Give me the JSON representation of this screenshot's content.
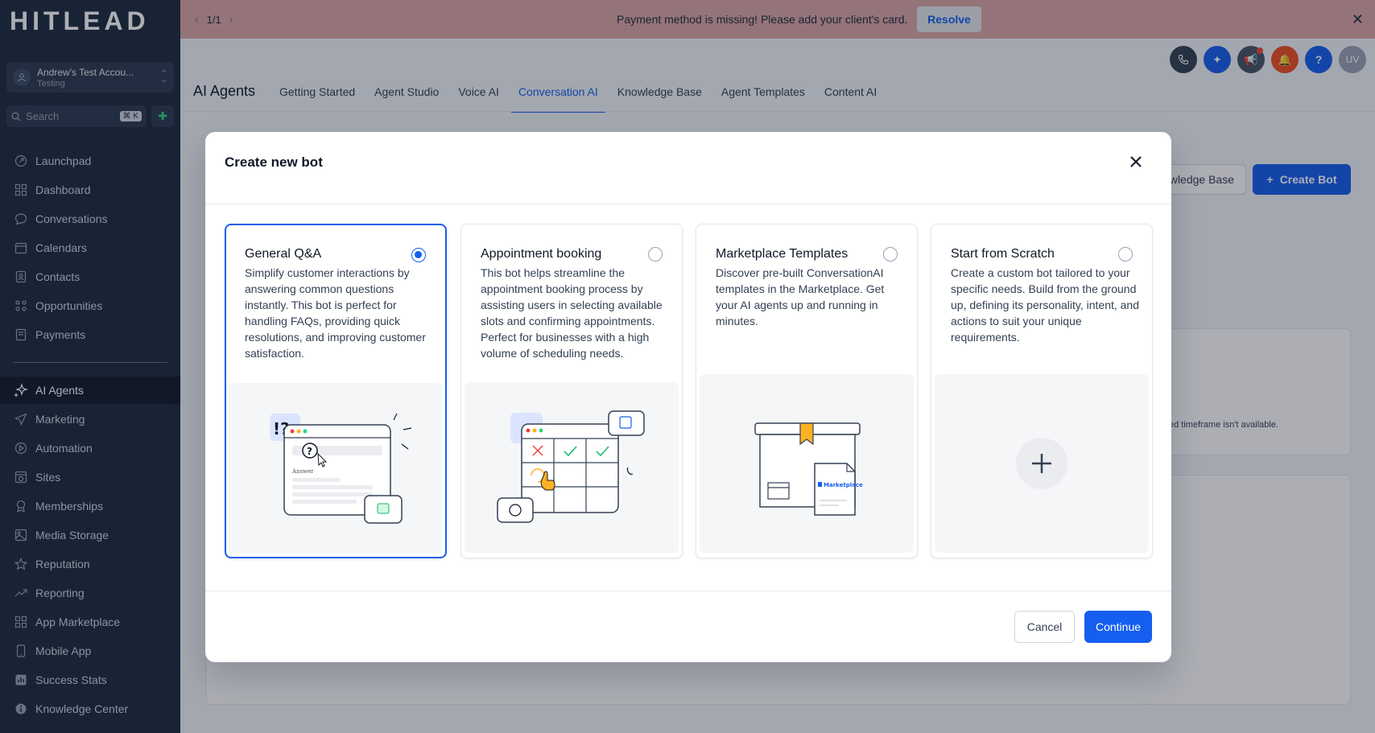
{
  "sidebar": {
    "logo": "HITLEAD",
    "account": {
      "name": "Andrew's Test Accou...",
      "subtitle": "Testing"
    },
    "search": {
      "placeholder": "Search",
      "shortcut": "⌘ K"
    },
    "items": [
      {
        "label": "Launchpad",
        "icon": "rocket-icon"
      },
      {
        "label": "Dashboard",
        "icon": "grid-icon"
      },
      {
        "label": "Conversations",
        "icon": "chat-icon"
      },
      {
        "label": "Calendars",
        "icon": "calendar-icon"
      },
      {
        "label": "Contacts",
        "icon": "contacts-icon"
      },
      {
        "label": "Opportunities",
        "icon": "opportunities-icon"
      },
      {
        "label": "Payments",
        "icon": "payments-icon"
      }
    ],
    "items2": [
      {
        "label": "AI Agents",
        "icon": "sparkle-icon",
        "active": true
      },
      {
        "label": "Marketing",
        "icon": "send-icon"
      },
      {
        "label": "Automation",
        "icon": "automation-icon"
      },
      {
        "label": "Sites",
        "icon": "sites-icon"
      },
      {
        "label": "Memberships",
        "icon": "memberships-icon"
      },
      {
        "label": "Media Storage",
        "icon": "image-icon"
      },
      {
        "label": "Reputation",
        "icon": "star-icon"
      },
      {
        "label": "Reporting",
        "icon": "trend-icon"
      },
      {
        "label": "App Marketplace",
        "icon": "apps-icon"
      },
      {
        "label": "Mobile App",
        "icon": "mobile-icon"
      },
      {
        "label": "Success Stats",
        "icon": "stats-icon"
      },
      {
        "label": "Knowledge Center",
        "icon": "info-icon"
      }
    ]
  },
  "banner": {
    "pager": "1/1",
    "message": "Payment method is missing! Please add your client's card.",
    "resolve_label": "Resolve"
  },
  "header": {
    "title": "AI Agents",
    "tabs": [
      "Getting Started",
      "Agent Studio",
      "Voice AI",
      "Conversation AI",
      "Knowledge Base",
      "Agent Templates",
      "Content AI"
    ],
    "active_tab": "Conversation AI",
    "avatar_initials": "UV"
  },
  "background": {
    "kb_button": "wledge Base",
    "create_bot": "Create Bot",
    "note": "ed timeframe isn't available."
  },
  "modal": {
    "title": "Create new bot",
    "cards": [
      {
        "title": "General Q&A",
        "desc": "Simplify customer interactions by answering common questions instantly. This bot is perfect for handling FAQs, providing quick resolutions, and improving customer satisfaction.",
        "selected": true
      },
      {
        "title": "Appointment booking",
        "desc": "This bot helps streamline the appointment booking process by assisting users in selecting available slots and confirming appointments. Perfect for businesses with a high volume of scheduling needs.",
        "selected": false
      },
      {
        "title": "Marketplace Templates",
        "desc": "Discover pre-built ConversationAI templates in the Marketplace. Get your AI agents up and running in minutes.",
        "selected": false,
        "illustration_text": "Marketplace"
      },
      {
        "title": "Start from Scratch",
        "desc": "Create a custom bot tailored to your specific needs. Build from the ground up, defining its personality, intent, and actions to suit your unique requirements.",
        "selected": false
      }
    ],
    "illus_text": {
      "qa_marks": "!?",
      "qa_q": "?",
      "qa_answer": "Answer"
    },
    "cancel_label": "Cancel",
    "continue_label": "Continue"
  },
  "colors": {
    "primary": "#155eef",
    "sidebar": "#1d2a3c",
    "banner": "#dba6a4"
  }
}
